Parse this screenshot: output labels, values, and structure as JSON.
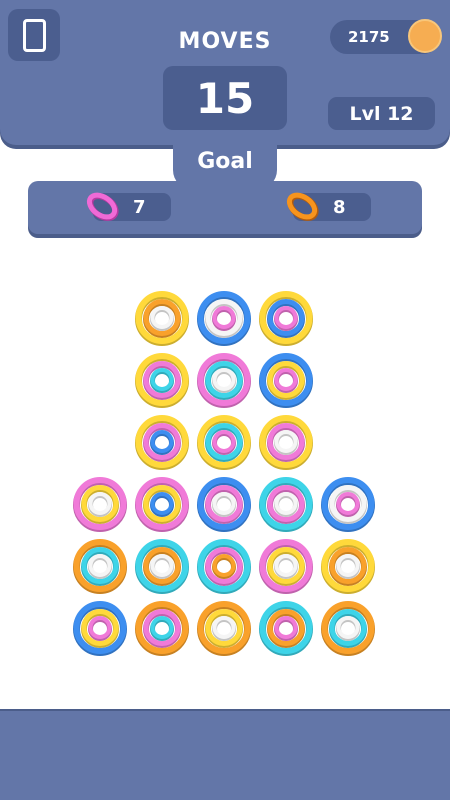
{
  "header": {
    "moves_label": "MOVES",
    "moves_value": "15",
    "coins": "2175",
    "level": "Lvl 12"
  },
  "goal": {
    "label": "Goal",
    "items": [
      {
        "color": "pink",
        "hex": "#f06ad6",
        "count": "7"
      },
      {
        "color": "orange",
        "hex": "#f7941d",
        "count": "8"
      }
    ]
  },
  "palette": {
    "yellow": "#ffd93b",
    "blue": "#3d8ef0",
    "pink": "#f07ad8",
    "cyan": "#3ed4e8",
    "orange": "#f9a12b",
    "white": "#f5f5f5"
  },
  "board": {
    "rows": [
      {
        "cells": [
          [
            "yellow",
            "orange",
            "white"
          ],
          [
            "blue",
            "white",
            "pink"
          ],
          [
            "yellow",
            "blue",
            "pink"
          ]
        ]
      },
      {
        "cells": [
          [
            "yellow",
            "pink",
            "cyan"
          ],
          [
            "pink",
            "cyan",
            "white"
          ],
          [
            "blue",
            "yellow",
            "pink"
          ]
        ]
      },
      {
        "cells": [
          [
            "yellow",
            "pink",
            "blue"
          ],
          [
            "yellow",
            "cyan",
            "pink"
          ],
          [
            "yellow",
            "pink",
            "white"
          ]
        ]
      },
      {
        "cells": [
          [
            "pink",
            "yellow",
            "white"
          ],
          [
            "pink",
            "yellow",
            "blue"
          ],
          [
            "blue",
            "pink",
            "white"
          ],
          [
            "cyan",
            "pink",
            "white"
          ],
          [
            "blue",
            "white",
            "pink"
          ]
        ]
      },
      {
        "cells": [
          [
            "orange",
            "cyan",
            "white"
          ],
          [
            "cyan",
            "orange",
            "white"
          ],
          [
            "cyan",
            "pink",
            "orange"
          ],
          [
            "pink",
            "yellow",
            "white"
          ],
          [
            "yellow",
            "orange",
            "white"
          ]
        ]
      },
      {
        "cells": [
          [
            "blue",
            "yellow",
            "pink"
          ],
          [
            "orange",
            "pink",
            "cyan"
          ],
          [
            "orange",
            "yellow",
            "white"
          ],
          [
            "cyan",
            "orange",
            "pink"
          ],
          [
            "orange",
            "cyan",
            "white"
          ]
        ]
      }
    ]
  }
}
